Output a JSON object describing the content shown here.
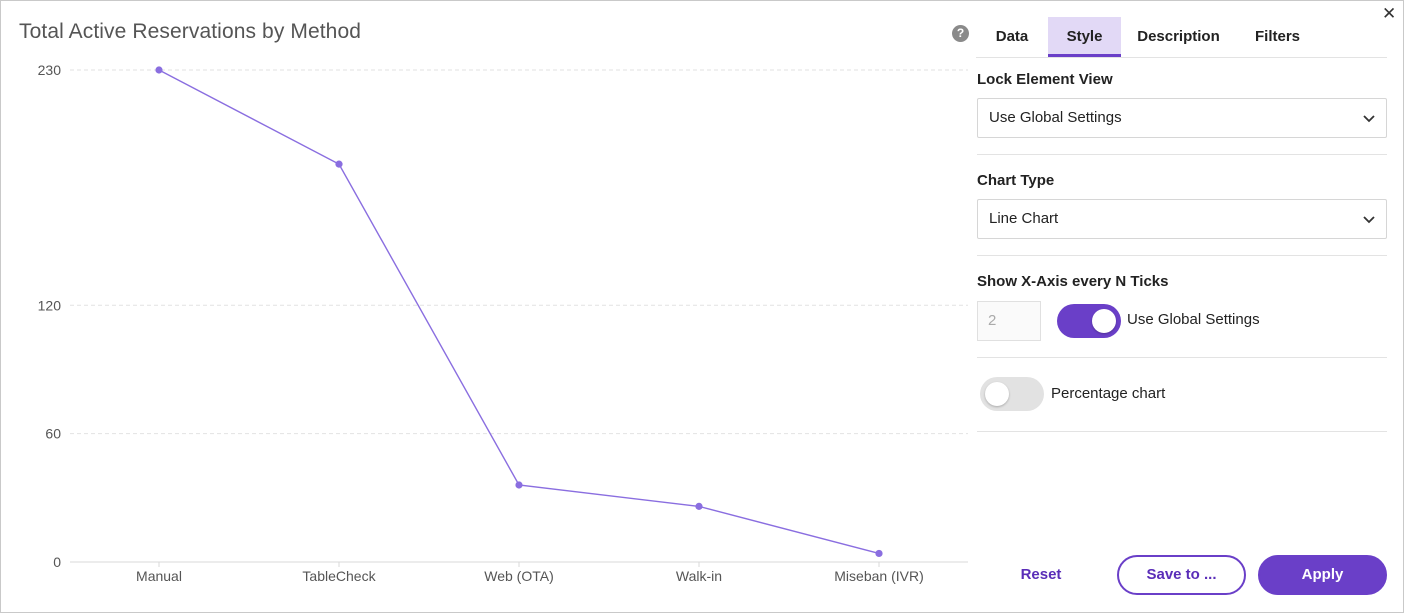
{
  "chart": {
    "title": "Total Active Reservations by Method"
  },
  "chart_data": {
    "type": "line",
    "categories": [
      "Manual",
      "TableCheck",
      "Web (OTA)",
      "Walk-in",
      "Miseban (IVR)"
    ],
    "values": [
      230,
      186,
      36,
      26,
      4
    ],
    "yticks": [
      0,
      60,
      120,
      230
    ],
    "ylim": [
      0,
      230
    ],
    "grid": true,
    "color": "#8a6ee0"
  },
  "panel": {
    "tabs": [
      {
        "label": "Data"
      },
      {
        "label": "Style"
      },
      {
        "label": "Description"
      },
      {
        "label": "Filters"
      }
    ],
    "active_tab": "Style",
    "lock_view": {
      "label": "Lock Element View",
      "value": "Use Global Settings"
    },
    "chart_type": {
      "label": "Chart Type",
      "value": "Line Chart"
    },
    "xaxis_ticks": {
      "label": "Show X-Axis every N Ticks",
      "placeholder": "2",
      "toggle_label": "Use Global Settings",
      "toggle_on": true
    },
    "percentage": {
      "label": "Percentage chart",
      "toggle_on": false
    },
    "buttons": {
      "reset": "Reset",
      "save": "Save to ...",
      "apply": "Apply"
    }
  },
  "icons": {
    "help": "?",
    "close": "✕"
  }
}
